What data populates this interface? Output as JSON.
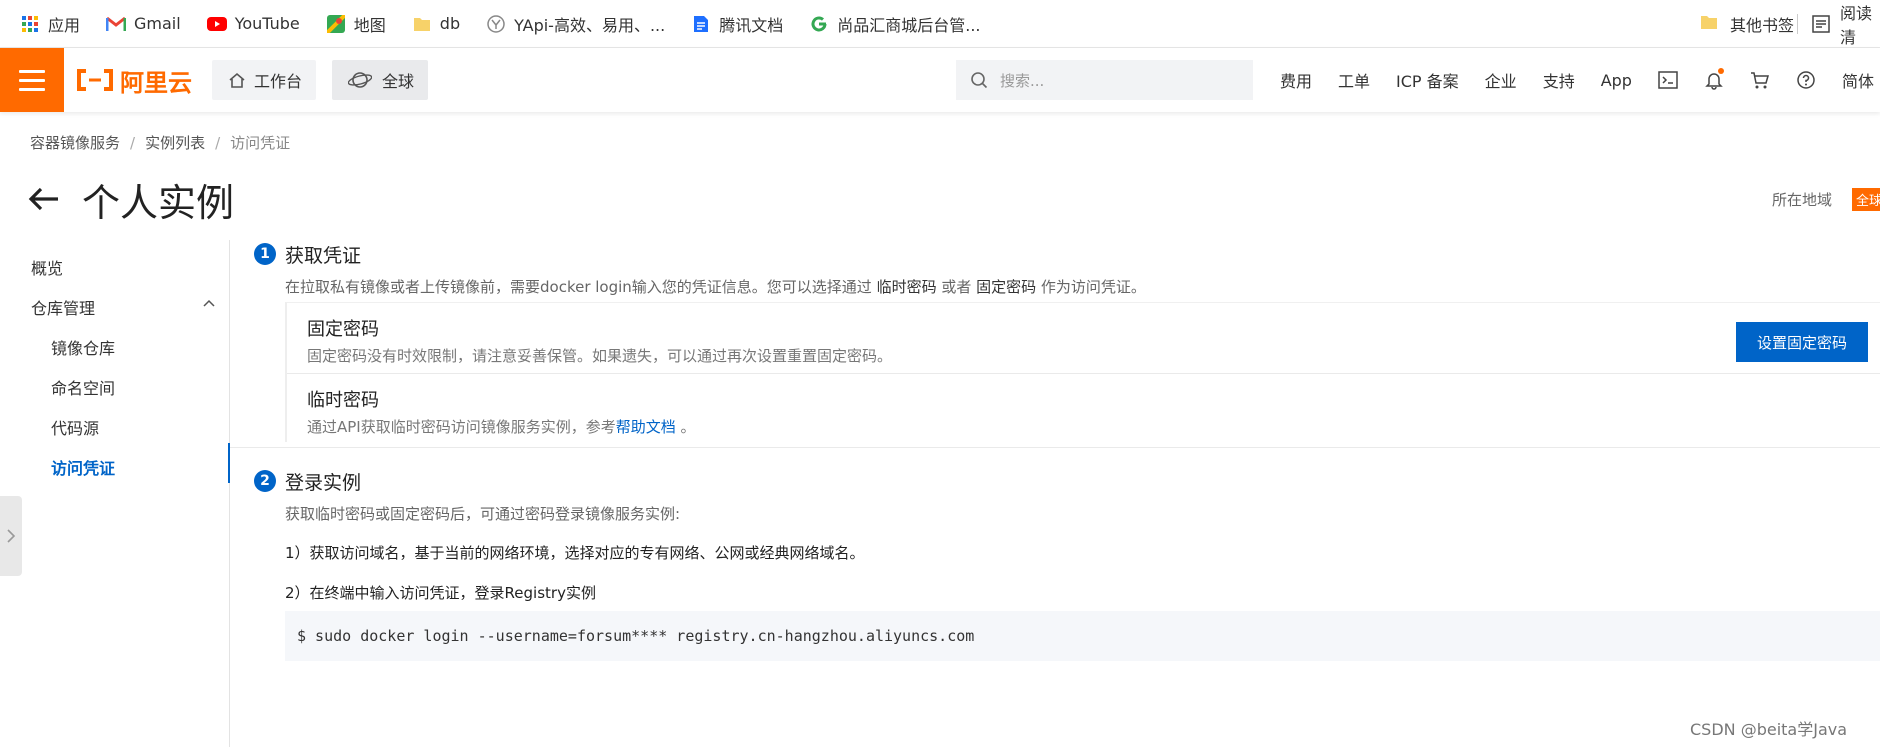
{
  "bookmarks": {
    "items": [
      {
        "label": "应用",
        "icon": "apps-grid-icon"
      },
      {
        "label": "Gmail",
        "icon": "gmail-icon"
      },
      {
        "label": "YouTube",
        "icon": "youtube-icon"
      },
      {
        "label": "地图",
        "icon": "maps-icon"
      },
      {
        "label": "db",
        "icon": "folder-icon"
      },
      {
        "label": "YApi-高效、易用、...",
        "icon": "yapi-icon"
      },
      {
        "label": "腾讯文档",
        "icon": "tencent-docs-icon"
      },
      {
        "label": "尚品汇商城后台管...",
        "icon": "google-g-icon"
      }
    ],
    "other_label": "其他书签",
    "reading_label": "阅读清"
  },
  "topbar": {
    "logo_text": "阿里云",
    "workbench_label": "工作台",
    "global_label": "全球",
    "search_placeholder": "搜索...",
    "links": [
      "费用",
      "工单",
      "ICP 备案",
      "企业",
      "支持",
      "App"
    ],
    "lang_label": "简体"
  },
  "breadcrumb": {
    "items": [
      "容器镜像服务",
      "实例列表",
      "访问凭证"
    ]
  },
  "page": {
    "title": "个人实例",
    "region_label": "所在地域",
    "region_value": "全球"
  },
  "sidebar": {
    "overview": "概览",
    "repo_mgmt": "仓库管理",
    "image_repo": "镜像仓库",
    "namespace": "命名空间",
    "code_source": "代码源",
    "access_cred": "访问凭证"
  },
  "step1": {
    "num": "1",
    "title": "获取凭证",
    "desc_pre": "在拉取私有镜像或者上传镜像前，需要docker login输入您的凭证信息。您可以选择通过 ",
    "desc_temp": "临时密码",
    "desc_or": " 或者 ",
    "desc_fixed": "固定密码",
    "desc_post": " 作为访问凭证。",
    "fixed": {
      "name": "固定密码",
      "desc": "固定密码没有时效限制，请注意妥善保管。如果遗失，可以通过再次设置重置固定密码。",
      "button": "设置固定密码"
    },
    "temp": {
      "name": "临时密码",
      "desc_pre": "通过API获取临时密码访问镜像服务实例，参考",
      "link": "帮助文档",
      "desc_post": " 。"
    }
  },
  "step2": {
    "num": "2",
    "title": "登录实例",
    "desc": "获取临时密码或固定密码后，可通过密码登录镜像服务实例:",
    "instr1": "1）获取访问域名，基于当前的网络环境，选择对应的专有网络、公网或经典网络域名。",
    "instr2": "2）在终端中输入访问凭证，登录Registry实例",
    "command": "$ sudo docker login --username=forsum**** registry.cn-hangzhou.aliyuncs.com"
  },
  "watermark": "CSDN @beita学Java",
  "colors": {
    "brand_orange": "#ff6a00",
    "primary_blue": "#0064c8"
  }
}
